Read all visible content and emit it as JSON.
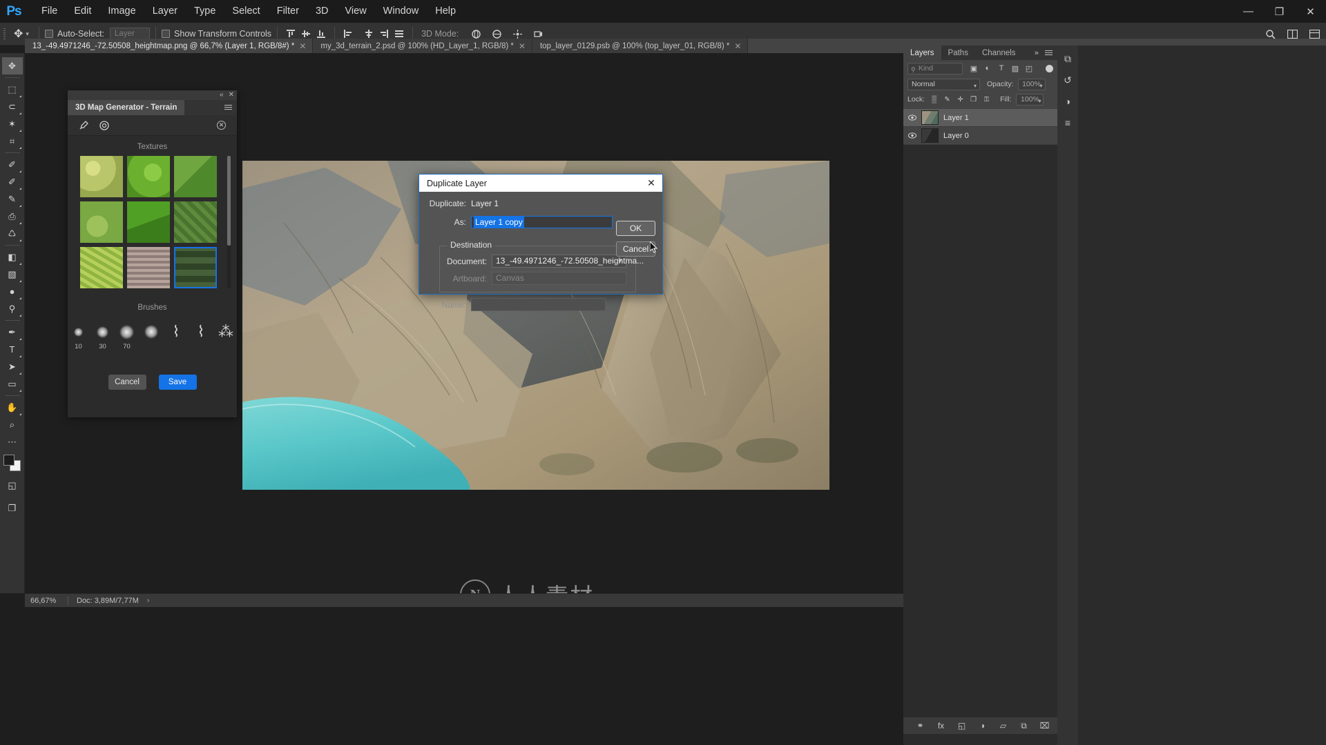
{
  "app": {
    "name": "Adobe Photoshop",
    "logo": "Ps"
  },
  "menubar": {
    "items": [
      {
        "label": "File"
      },
      {
        "label": "Edit"
      },
      {
        "label": "Image"
      },
      {
        "label": "Layer"
      },
      {
        "label": "Type"
      },
      {
        "label": "Select"
      },
      {
        "label": "Filter"
      },
      {
        "label": "3D"
      },
      {
        "label": "View"
      },
      {
        "label": "Window"
      },
      {
        "label": "Help"
      }
    ],
    "window_controls": {
      "minimize": "—",
      "maximize": "❐",
      "close": "✕"
    }
  },
  "options_bar": {
    "tool_icon": "move-tool",
    "tool_caret": "▾",
    "auto_select_label": "Auto-Select:",
    "auto_select_checked": false,
    "layer_combo_value": "Layer",
    "show_transform_label": "Show Transform Controls",
    "show_transform_checked": false,
    "mode_3d_label": "3D Mode:",
    "search_icon": "search-icon",
    "arrange_icon": "arrange-documents-icon",
    "workspace_icon": "workspace-switcher-icon"
  },
  "tabs": [
    {
      "label": "13_-49.4971246_-72.50508_heightmap.png @ 66,7% (Layer 1, RGB/8#) *",
      "active": true,
      "close": "✕"
    },
    {
      "label": "my_3d_terrain_2.psd @ 100% (HD_Layer_1, RGB/8) *",
      "active": false,
      "close": "✕"
    },
    {
      "label": "top_layer_0129.psb @ 100% (top_layer_01, RGB/8) *",
      "active": false,
      "close": "✕"
    }
  ],
  "toolbar": {
    "tools": [
      {
        "name": "move-tool",
        "glyph": "✥",
        "selected": true,
        "corner": false
      },
      {
        "name": "rectangular-marquee-tool",
        "glyph": "⬚",
        "selected": false,
        "corner": true
      },
      {
        "name": "lasso-tool",
        "glyph": "⊂",
        "selected": false,
        "corner": true
      },
      {
        "name": "quick-selection-tool",
        "glyph": "✶",
        "selected": false,
        "corner": true
      },
      {
        "name": "crop-tool",
        "glyph": "⌗",
        "selected": false,
        "corner": true
      },
      {
        "name": "eyedropper-tool",
        "glyph": "✐",
        "selected": false,
        "corner": true
      },
      {
        "name": "spot-healing-brush-tool",
        "glyph": "✐",
        "selected": false,
        "corner": true
      },
      {
        "name": "brush-tool",
        "glyph": "✎",
        "selected": false,
        "corner": true
      },
      {
        "name": "clone-stamp-tool",
        "glyph": "⎙",
        "selected": false,
        "corner": true
      },
      {
        "name": "history-brush-tool",
        "glyph": "♺",
        "selected": false,
        "corner": true
      },
      {
        "name": "eraser-tool",
        "glyph": "◧",
        "selected": false,
        "corner": true
      },
      {
        "name": "gradient-tool",
        "glyph": "▧",
        "selected": false,
        "corner": true
      },
      {
        "name": "blur-tool",
        "glyph": "●",
        "selected": false,
        "corner": true
      },
      {
        "name": "dodge-tool",
        "glyph": "⚲",
        "selected": false,
        "corner": true
      },
      {
        "name": "pen-tool",
        "glyph": "✒",
        "selected": false,
        "corner": true
      },
      {
        "name": "type-tool",
        "glyph": "T",
        "selected": false,
        "corner": true
      },
      {
        "name": "path-selection-tool",
        "glyph": "➤",
        "selected": false,
        "corner": true
      },
      {
        "name": "rectangle-tool",
        "glyph": "▭",
        "selected": false,
        "corner": true
      },
      {
        "name": "hand-tool",
        "glyph": "✋",
        "selected": false,
        "corner": true
      },
      {
        "name": "zoom-tool",
        "glyph": "⌕",
        "selected": false,
        "corner": false
      },
      {
        "name": "more-tools",
        "glyph": "⋯",
        "selected": false,
        "corner": false
      }
    ],
    "foreground_color": "#1c1c1c",
    "background_color": "#f2f2f2",
    "quick_mask_glyph": "◱",
    "screen_mode_glyph": "❐"
  },
  "map_generator": {
    "panel_title": "3D Map Generator - Terrain",
    "collapse_glyph": "«",
    "close_glyph": "✕",
    "tool_icons": [
      {
        "name": "eyedropper-icon",
        "glyph": "✐"
      },
      {
        "name": "target-icon",
        "glyph": "◎"
      }
    ],
    "reset_glyph": "✕",
    "textures_title": "Textures",
    "texture_swatches": [
      {
        "name": "texture-1",
        "color": "#b8c16a"
      },
      {
        "name": "texture-2",
        "color": "#73b133"
      },
      {
        "name": "texture-3",
        "color": "#5f9437"
      },
      {
        "name": "texture-4",
        "color": "#7da24a"
      },
      {
        "name": "texture-5",
        "color": "#3f8a1e"
      },
      {
        "name": "texture-6",
        "color": "#55803a"
      },
      {
        "name": "texture-7",
        "color": "#9dbd4a"
      },
      {
        "name": "texture-8",
        "color": "#a08b86"
      },
      {
        "name": "texture-9",
        "color": "#3d5230"
      }
    ],
    "selected_texture_index": 8,
    "brushes_title": "Brushes",
    "brush_sizes": [
      {
        "label": "10",
        "size": 13
      },
      {
        "label": "30",
        "size": 17
      },
      {
        "label": "70",
        "size": 21
      }
    ],
    "brush_extra": [
      {
        "name": "brush-soft-round",
        "size": 20
      },
      {
        "name": "brush-stroke-1",
        "glyph": "⌇"
      },
      {
        "name": "brush-stroke-2",
        "glyph": "⌇"
      },
      {
        "name": "brush-scatter",
        "glyph": "⁂"
      }
    ],
    "cancel_label": "Cancel",
    "save_label": "Save"
  },
  "dialog": {
    "title": "Duplicate Layer",
    "close_glyph": "✕",
    "duplicate_label": "Duplicate:",
    "duplicate_value": "Layer 1",
    "as_label": "As:",
    "as_value": "Layer 1 copy",
    "destination_legend": "Destination",
    "document_label": "Document:",
    "document_value": "13_-49.4971246_-72.50508_heightma...",
    "document_caret": "▾",
    "artboard_label": "Artboard:",
    "artboard_value": "Canvas",
    "name_label": "Name:",
    "name_value": "",
    "ok_label": "OK",
    "cancel_label": "Cancel"
  },
  "status_bar": {
    "zoom": "66,67%",
    "doc_label": "Doc:",
    "doc_value": "3,89M/7,77M",
    "arrow": "›"
  },
  "watermark": {
    "logo_letter": "N",
    "text": "人人素材"
  },
  "layers_panel": {
    "tabs": [
      {
        "label": "Layers",
        "active": true
      },
      {
        "label": "Paths",
        "active": false
      },
      {
        "label": "Channels",
        "active": false
      }
    ],
    "tab_expand_glyph": "»",
    "tab_menu_glyph": "menu-icon",
    "filter": {
      "kind_placeholder": "Kind",
      "search_glyph": "⚲",
      "icons": [
        {
          "name": "filter-pixel-icon",
          "glyph": "▣"
        },
        {
          "name": "filter-adjustment-icon",
          "glyph": "◐"
        },
        {
          "name": "filter-type-icon",
          "glyph": "T"
        },
        {
          "name": "filter-shape-icon",
          "glyph": "▨"
        },
        {
          "name": "filter-smart-object-icon",
          "glyph": "◰"
        }
      ],
      "toggle_on": true
    },
    "blend_mode": "Normal",
    "blend_caret": "▾",
    "opacity_label": "Opacity:",
    "opacity_value": "100%",
    "lock_label": "Lock:",
    "lock_icons": [
      {
        "name": "lock-transparent-pixels-icon",
        "glyph": "▒"
      },
      {
        "name": "lock-image-pixels-icon",
        "glyph": "✎"
      },
      {
        "name": "lock-position-icon",
        "glyph": "✛"
      },
      {
        "name": "lock-artboard-nesting-icon",
        "glyph": "❐"
      },
      {
        "name": "lock-all-icon",
        "glyph": "⚿"
      }
    ],
    "fill_label": "Fill:",
    "fill_value": "100%",
    "layers": [
      {
        "name": "Layer 1",
        "visible": true,
        "selected": true,
        "thumb": "terrain"
      },
      {
        "name": "Layer 0",
        "visible": true,
        "selected": false,
        "thumb": "dark"
      }
    ],
    "bottom_icons": [
      {
        "name": "link-layers-icon",
        "glyph": "⚭"
      },
      {
        "name": "layer-style-icon",
        "glyph": "fx"
      },
      {
        "name": "layer-mask-icon",
        "glyph": "◱"
      },
      {
        "name": "adjustment-layer-icon",
        "glyph": "◑"
      },
      {
        "name": "new-group-icon",
        "glyph": "▱"
      },
      {
        "name": "new-layer-icon",
        "glyph": "⧉"
      },
      {
        "name": "delete-layer-icon",
        "glyph": "⌧"
      }
    ]
  },
  "right_strip_icons": [
    {
      "name": "layers-panel-icon",
      "glyph": "⧉"
    },
    {
      "name": "history-panel-icon",
      "glyph": "↺"
    },
    {
      "name": "adjustments-panel-icon",
      "glyph": "◑"
    },
    {
      "name": "properties-panel-icon",
      "glyph": "≡"
    }
  ]
}
